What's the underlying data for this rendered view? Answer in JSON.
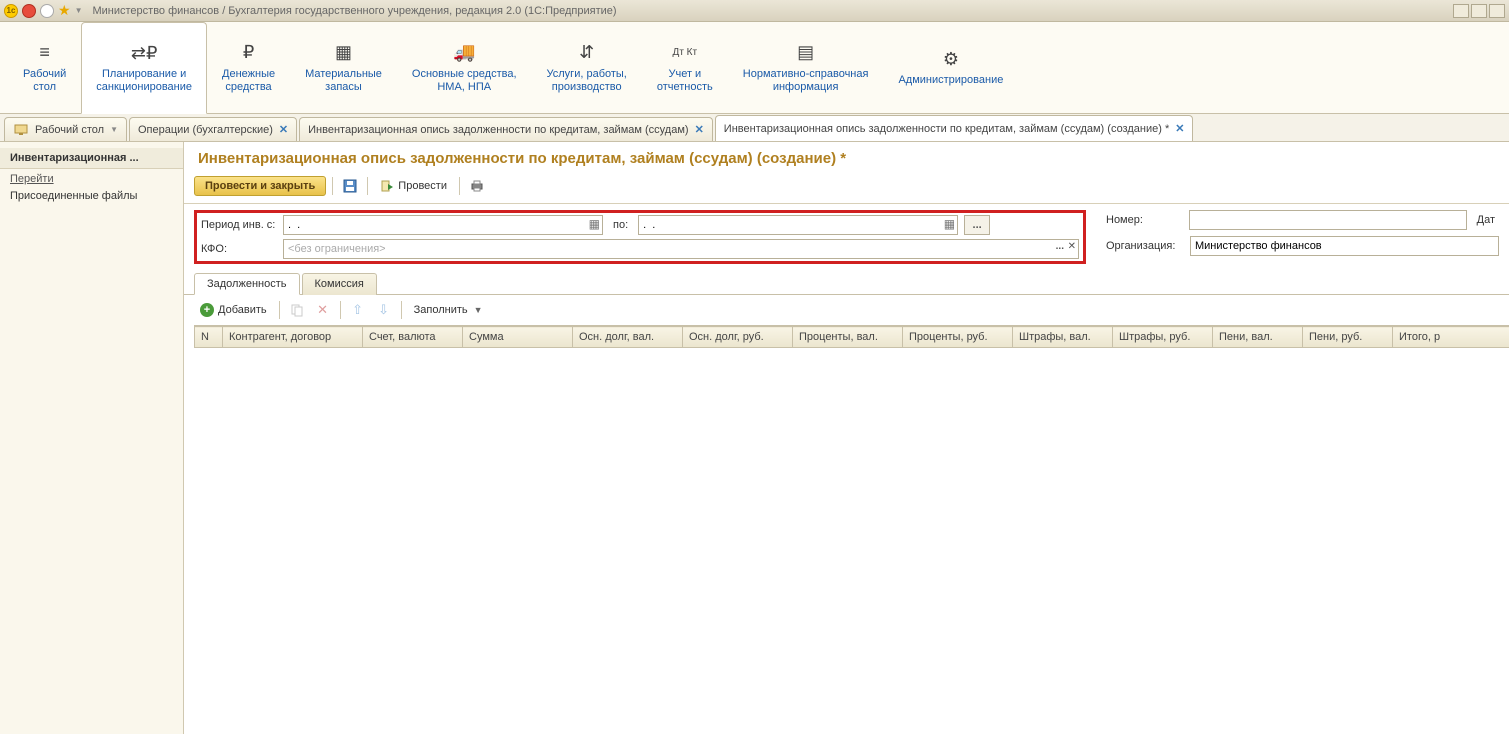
{
  "titlebar": {
    "text": "Министерство финансов / Бухгалтерия государственного учреждения, редакция 2.0  (1С:Предприятие)"
  },
  "sections": [
    {
      "icon": "≡",
      "l1": "Рабочий",
      "l2": "стол"
    },
    {
      "icon": "⇄₽",
      "l1": "Планирование и",
      "l2": "санкционирование"
    },
    {
      "icon": "₽",
      "l1": "Денежные",
      "l2": "средства"
    },
    {
      "icon": "▦",
      "l1": "Материальные",
      "l2": "запасы"
    },
    {
      "icon": "🚚",
      "l1": "Основные средства,",
      "l2": "НМА, НПА"
    },
    {
      "icon": "⇵",
      "l1": "Услуги, работы,",
      "l2": "производство"
    },
    {
      "icon": "Дт Кт",
      "l1": "Учет и",
      "l2": "отчетность"
    },
    {
      "icon": "▤",
      "l1": "Нормативно-справочная",
      "l2": "информация"
    },
    {
      "icon": "⚙",
      "l1": "Администрирование",
      "l2": ""
    }
  ],
  "doctabs": [
    {
      "label": "Рабочий стол",
      "icon": "desktop",
      "closable": false
    },
    {
      "label": "Операции (бухгалтерские)",
      "closable": true
    },
    {
      "label": "Инвентаризационная опись задолженности по кредитам, займам (ссудам)",
      "closable": true
    },
    {
      "label": "Инвентаризационная опись задолженности по кредитам, займам (ссудам) (создание) *",
      "closable": true,
      "active": true
    }
  ],
  "sidepanel": {
    "head": "Инвентаризационная ...",
    "goto_label": "Перейти",
    "links": [
      "Присоединенные файлы"
    ]
  },
  "doc": {
    "title": "Инвентаризационная опись задолженности по кредитам, займам (ссудам) (создание) *",
    "cmd": {
      "post_close": "Провести и закрыть",
      "post": "Провести"
    },
    "fields": {
      "period_from_lbl": "Период инв. с:",
      "period_from_val": ".  .",
      "period_to_lbl": "по:",
      "period_to_val": ".  .",
      "kfo_lbl": "КФО:",
      "kfo_placeholder": "<без ограничения>",
      "number_lbl": "Номер:",
      "number_val": "",
      "date_lbl": "Дат",
      "org_lbl": "Организация:",
      "org_val": "Министерство финансов"
    },
    "innertabs": [
      "Задолженность",
      "Комиссия"
    ],
    "listcmd": {
      "add": "Добавить",
      "fill": "Заполнить"
    },
    "columns": [
      "N",
      "Контрагент, договор",
      "Счет, валюта",
      "Сумма",
      "Осн. долг, вал.",
      "Осн. долг, руб.",
      "Проценты, вал.",
      "Проценты, руб.",
      "Штрафы, вал.",
      "Штрафы, руб.",
      "Пени, вал.",
      "Пени, руб.",
      "Итого, р"
    ]
  }
}
